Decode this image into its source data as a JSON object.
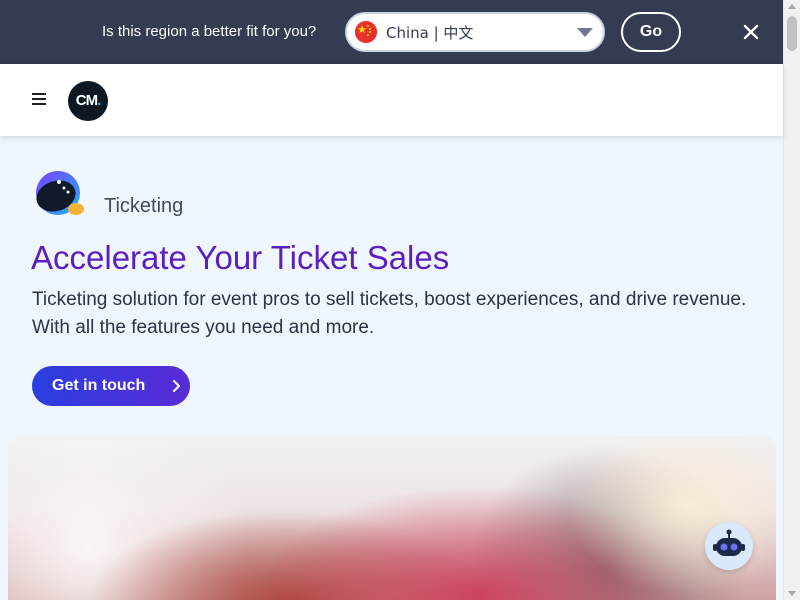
{
  "region_banner": {
    "question": "Is this region a better fit for you?",
    "selected_region": "China | 中文",
    "flag": "china-flag-icon",
    "go_label": "Go",
    "close_icon": "close-icon",
    "background_color": "#353c51"
  },
  "header": {
    "menu_icon": "hamburger-menu-icon",
    "logo_text": "CM",
    "logo_dot": "."
  },
  "hero": {
    "product_icon": "ticketing-product-icon",
    "product_name": "Ticketing",
    "title": "Accelerate Your Ticket Sales",
    "description": "Ticketing solution for event pros to sell tickets, boost experiences, and drive revenue. With all the features you need and more.",
    "cta_label": "Get in touch",
    "cta_icon": "chevron-right-icon",
    "title_color": "#5b1fc1",
    "cta_gradient": [
      "#2a3fe0",
      "#5a2bd6"
    ]
  },
  "chat": {
    "icon": "chat-bot-icon"
  }
}
